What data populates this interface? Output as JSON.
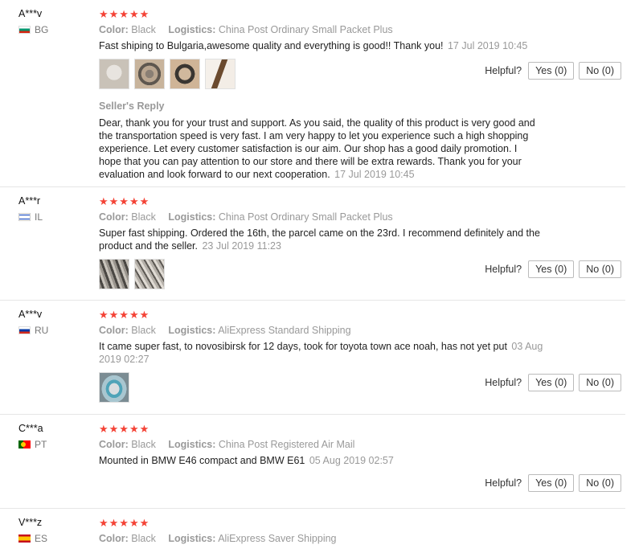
{
  "helpful_label": "Helpful?",
  "reviews": [
    {
      "user": "A***v",
      "country": "BG",
      "stars": "★★★★★",
      "color_label": "Color:",
      "color": "Black",
      "logistics_label": "Logistics:",
      "logistics": "China Post Ordinary Small Packet Plus",
      "text": "Fast shiping to Bulgaria,awesome quality and everything is good!! Thank you!",
      "date": "17 Jul 2019 10:45",
      "yes": "Yes (0)",
      "no": "No (0)",
      "reply_title": "Seller's Reply",
      "reply_text": "Dear, thank you for your trust and support. As you said, the quality of this product is very good and the transportation speed is very fast. I am very happy to let you experience such a high shopping experience. Let every customer satisfaction is our aim. Our shop has a good daily promotion. I hope that you can pay attention to our store and there will be extra rewards. Thank you for your evaluation and look forward to our next cooperation.",
      "reply_date": "17 Jul 2019 10:45"
    },
    {
      "user": "A***r",
      "country": "IL",
      "stars": "★★★★★",
      "color_label": "Color:",
      "color": "Black",
      "logistics_label": "Logistics:",
      "logistics": "China Post Ordinary Small Packet Plus",
      "text": "Super fast shipping. Ordered the 16th, the parcel came on the 23rd. I recommend definitely and the product and the seller.",
      "date": "23 Jul 2019 11:23",
      "yes": "Yes (0)",
      "no": "No (0)"
    },
    {
      "user": "A***v",
      "country": "RU",
      "stars": "★★★★★",
      "color_label": "Color:",
      "color": "Black",
      "logistics_label": "Logistics:",
      "logistics": "AliExpress Standard Shipping",
      "text": "It came super fast, to novosibirsk for 12 days, took for toyota town ace noah, has not yet put",
      "date": "03 Aug 2019 02:27",
      "yes": "Yes (0)",
      "no": "No (0)"
    },
    {
      "user": "C***a",
      "country": "PT",
      "stars": "★★★★★",
      "color_label": "Color:",
      "color": "Black",
      "logistics_label": "Logistics:",
      "logistics": "China Post Registered Air Mail",
      "text": "Mounted in BMW E46 compact and BMW E61",
      "date": "05 Aug 2019 02:57",
      "yes": "Yes (0)",
      "no": "No (0)"
    },
    {
      "user": "V***z",
      "country": "ES",
      "stars": "★★★★★",
      "color_label": "Color:",
      "color": "Black",
      "logistics_label": "Logistics:",
      "logistics": "AliExpress Saver Shipping"
    }
  ]
}
